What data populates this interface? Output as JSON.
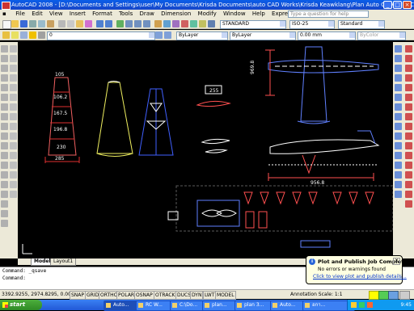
{
  "window": {
    "title": "AutoCAD 2008 - [D:\\Documents and Settings\\user\\My Documents\\Krisda Documents\\auto CAD Works\\Krisda  Keawklang\\Plan  Auto CAD\\Auto Cad 20...",
    "min": "_",
    "max": "□",
    "close": "×"
  },
  "menu": {
    "items": [
      "File",
      "Edit",
      "View",
      "Insert",
      "Format",
      "Tools",
      "Draw",
      "Dimension",
      "Modify",
      "Window",
      "Help",
      "Express"
    ],
    "ask_placeholder": "Type a question for help"
  },
  "toolbar2": {
    "style": "STANDARD",
    "dimstyle": "ISO-25",
    "tablestyle": "Standard"
  },
  "toolbar3": {
    "layer": "0",
    "color": "ByLayer",
    "linetype": "ByLayer",
    "lineweight": "0.00 mm",
    "plotstyle": "ByColor"
  },
  "drawing": {
    "dims_tapered": [
      "105",
      "106.2",
      "167.5",
      "196.8",
      "230",
      "285"
    ],
    "dim_small": "255",
    "dim_vertical": "969.8",
    "dim_horizontal": "956.8"
  },
  "tabs": [
    "Model",
    "Layout1"
  ],
  "command": {
    "line1": "Command: _qsave",
    "line2": "Command:"
  },
  "status": {
    "coords": "3392.9255, 2974.8295, 0.0000",
    "buttons": [
      "SNAP",
      "GRID",
      "ORTHO",
      "POLAR",
      "OSNAP",
      "OTRACK",
      "DUCS",
      "DYN",
      "LWT",
      "MODEL"
    ],
    "annotation_scale": "Annotation Scale: 1:1"
  },
  "balloon": {
    "title": "Plot and Publish Job Complete",
    "message": "No errors or warnings found",
    "link": "Click to view plot and publish details...",
    "close": "×"
  },
  "taskbar": {
    "start": "start",
    "tasks": [
      "Auto...",
      "RC W...",
      "C:\\Do...",
      "plan...",
      "plan 3...",
      "Auto...",
      "อกา..."
    ],
    "clock": "9:45"
  },
  "colors": {
    "canvas": "#000000",
    "red_geometry": "#e03030",
    "yellow_geometry": "#f0f060",
    "blue_geometry": "#4060ff",
    "dim_line": "#ff5050",
    "chrome": "#ece9d8",
    "title_blue": "#0a5ee8"
  }
}
